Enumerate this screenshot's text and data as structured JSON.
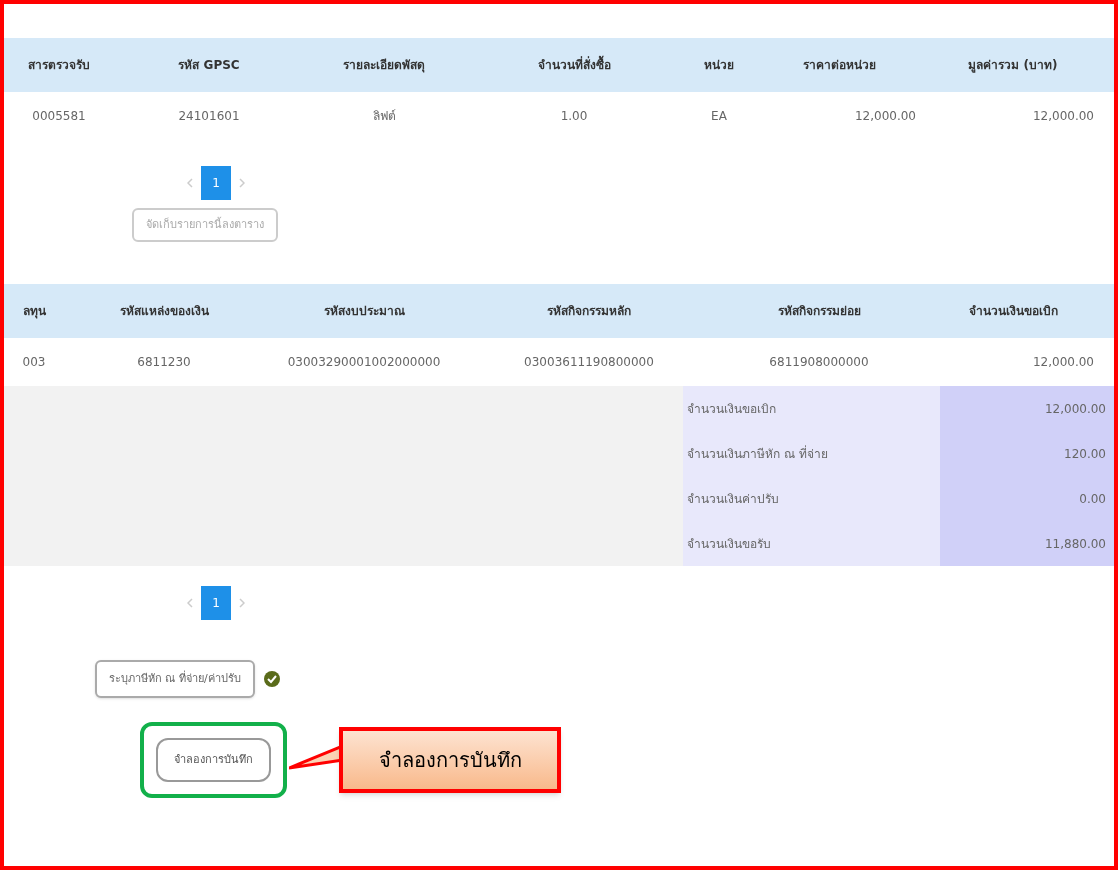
{
  "items_table": {
    "columns": [
      "สารตรวจรับ",
      "รหัส GPSC",
      "รายละเอียดพัสดุ",
      "จำนวนที่สั่งซื้อ",
      "หน่วย",
      "ราคาต่อหน่วย",
      "มูลค่ารวม (บาท)"
    ],
    "rows": [
      [
        "0005581",
        "24101601",
        "ลิฟต์",
        "1.00",
        "EA",
        "12,000.00",
        "12,000.00"
      ]
    ]
  },
  "items_pagination": {
    "pages": [
      {
        "label": "1",
        "selected": true
      }
    ]
  },
  "save_items_button": {
    "label": "จัดเก็บรายการนี้ลงตาราง"
  },
  "budget_table": {
    "columns": [
      "ลทุน",
      "รหัสแหล่งของเงิน",
      "รหัสงบประมาณ",
      "รหัสกิจกรรมหลัก",
      "รหัสกิจกรรมย่อย",
      "จำนวนเงินขอเบิก"
    ],
    "rows": [
      [
        "003",
        "6811230",
        "03003290001002000000",
        "03003611190800000",
        "6811908000000",
        "12,000.00"
      ]
    ]
  },
  "summary": [
    {
      "label": "จำนวนเงินขอเบิก",
      "value": "12,000.00"
    },
    {
      "label": "จำนวนเงินภาษีหัก ณ ที่จ่าย",
      "value": "120.00"
    },
    {
      "label": "จำนวนเงินค่าปรับ",
      "value": "0.00"
    },
    {
      "label": "จำนวนเงินขอรับ",
      "value": "11,880.00"
    }
  ],
  "budget_pagination": {
    "pages": [
      {
        "label": "1",
        "selected": true
      }
    ]
  },
  "tax_button": {
    "label": "ระบุภาษีหัก ณ ที่จ่าย/ค่าปรับ",
    "done": true
  },
  "simulate_button": {
    "label": "จำลองการบันทึก",
    "highlighted": true
  },
  "callout": {
    "text": "จำลองการบันทึก"
  }
}
